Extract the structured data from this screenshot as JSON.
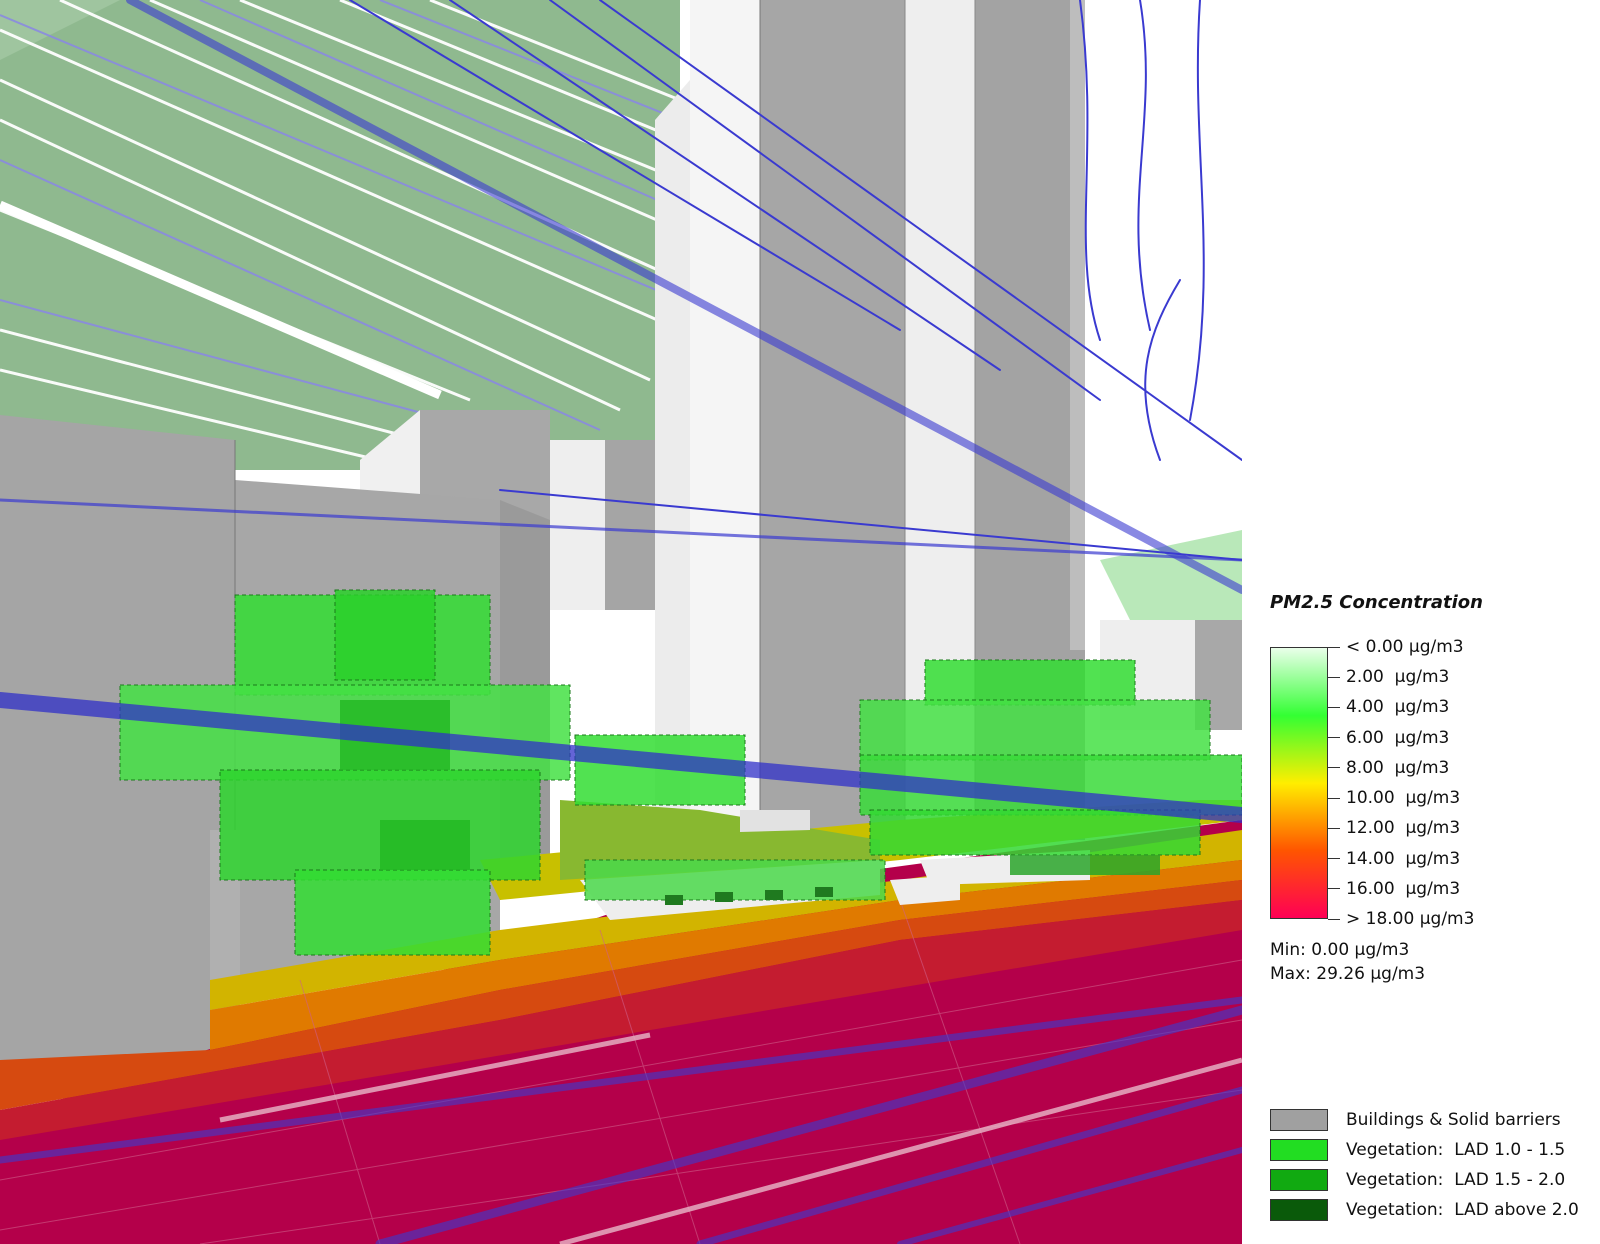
{
  "legend": {
    "title": "PM2.5 Concentration",
    "colorbar_stops": [
      "#eaffea",
      "#33ff33",
      "#ffee00",
      "#ff5500",
      "#ff0055"
    ],
    "ticks": [
      "< 0.00 μg/m3",
      "2.00  μg/m3",
      "4.00  μg/m3",
      "6.00  μg/m3",
      "8.00  μg/m3",
      "10.00  μg/m3",
      "12.00  μg/m3",
      "14.00  μg/m3",
      "16.00  μg/m3",
      "> 18.00 μg/m3"
    ],
    "min_label": "Min: 0.00 μg/m3",
    "max_label": "Max: 29.26 μg/m3",
    "categories": [
      {
        "label": "Buildings & Solid barriers",
        "color": "#a0a0a0"
      },
      {
        "label": "Vegetation:  LAD 1.0 - 1.5",
        "color": "#22dd22"
      },
      {
        "label": "Vegetation:  LAD 1.5 - 2.0",
        "color": "#11aa11"
      },
      {
        "label": "Vegetation:  LAD above 2.0",
        "color": "#0a5a0a"
      }
    ]
  },
  "colors": {
    "road": "#b4004a",
    "building_gray": "#a0a0a0",
    "building_light": "#eeeeee",
    "sky_tint": "#8db88d",
    "streamline": "#3a3ad0"
  }
}
